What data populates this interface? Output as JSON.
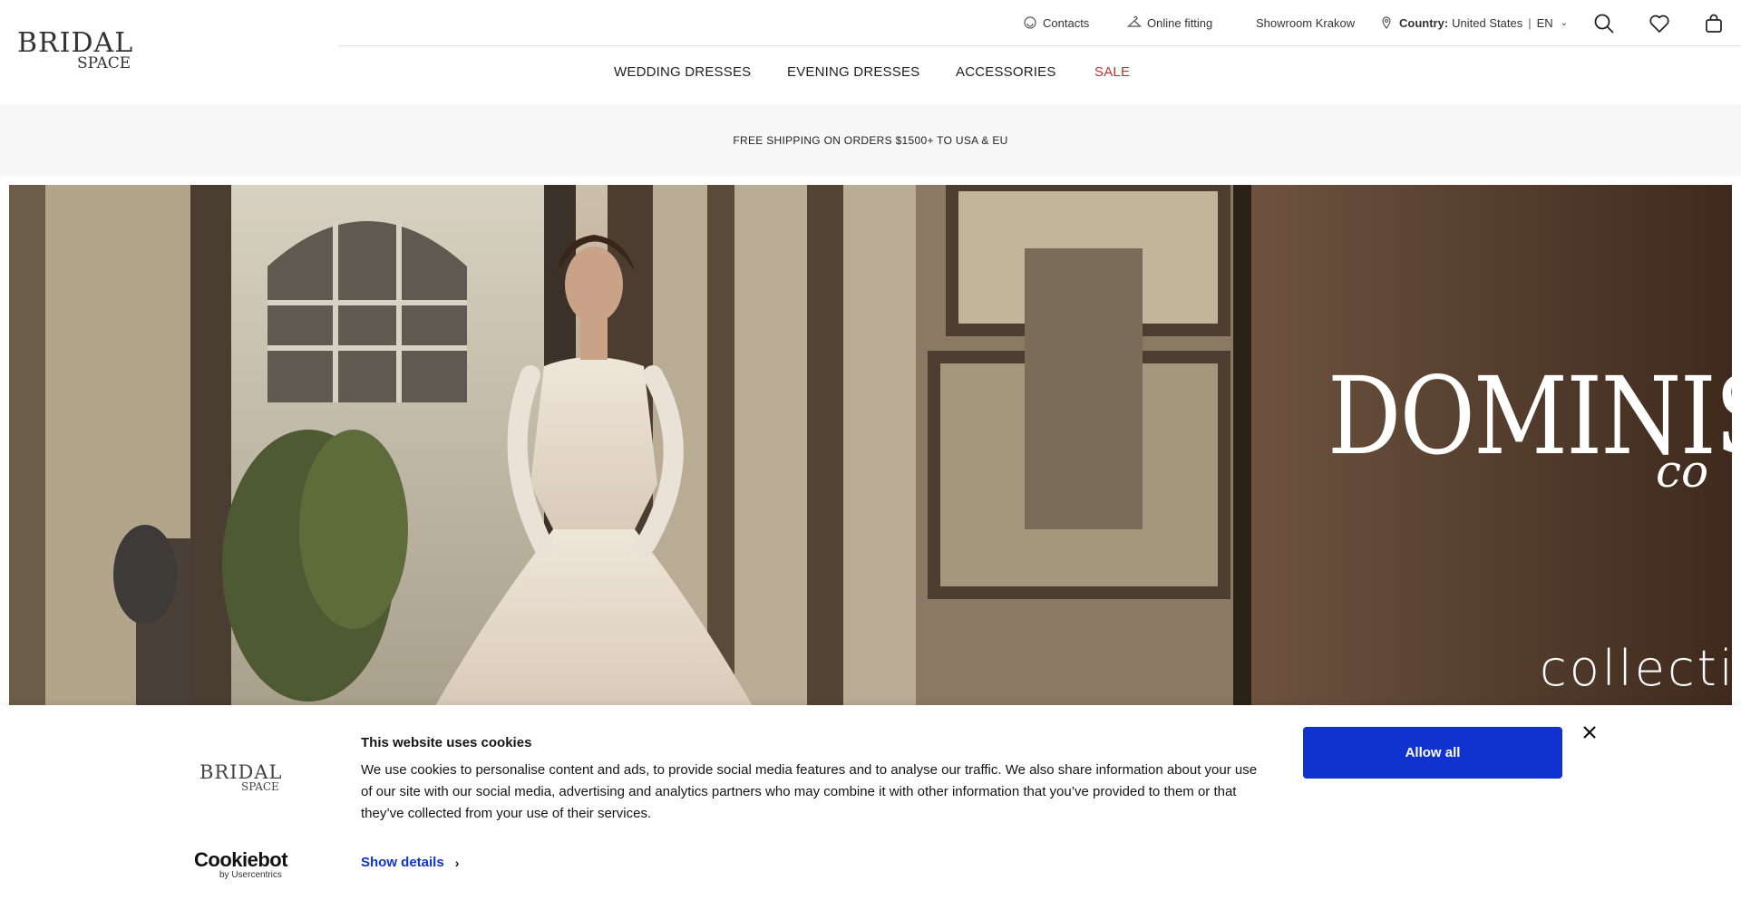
{
  "header": {
    "logo_line1": "BRIDAL",
    "logo_line2": "SPACE",
    "utility": {
      "contacts": "Contacts",
      "online_fitting": "Online fitting",
      "showroom": "Showroom Krakow",
      "country_label": "Country:",
      "country_value": "United States",
      "language": "EN"
    },
    "icons": [
      "search-icon",
      "heart-icon",
      "bag-icon"
    ]
  },
  "nav": {
    "items": [
      {
        "label": "WEDDING DRESSES"
      },
      {
        "label": "EVENING DRESSES"
      },
      {
        "label": "ACCESSORIES"
      },
      {
        "label": "SALE",
        "color": "#b8343a"
      }
    ]
  },
  "shipping": {
    "text": "FREE SHIPPING ON ORDERS $1500+ TO USA & EU"
  },
  "hero": {
    "brand": "DOMINIS",
    "brand_script": "co",
    "subtitle": "collectio"
  },
  "cookie": {
    "logo_line1": "BRIDAL",
    "logo_line2": "SPACE",
    "title": "This website uses cookies",
    "body": "We use cookies to personalise content and ads, to provide social media features and to analyse our traffic. We also share information about your use of our site with our social media, advertising and analytics partners who may combine it with other information that you’ve provided to them or that they’ve collected from your use of their services.",
    "show_details": "Show details",
    "allow_all": "Allow all",
    "provider": "Cookiebot",
    "provider_sub": "by Usercentrics",
    "accent_color": "#1032cf"
  }
}
